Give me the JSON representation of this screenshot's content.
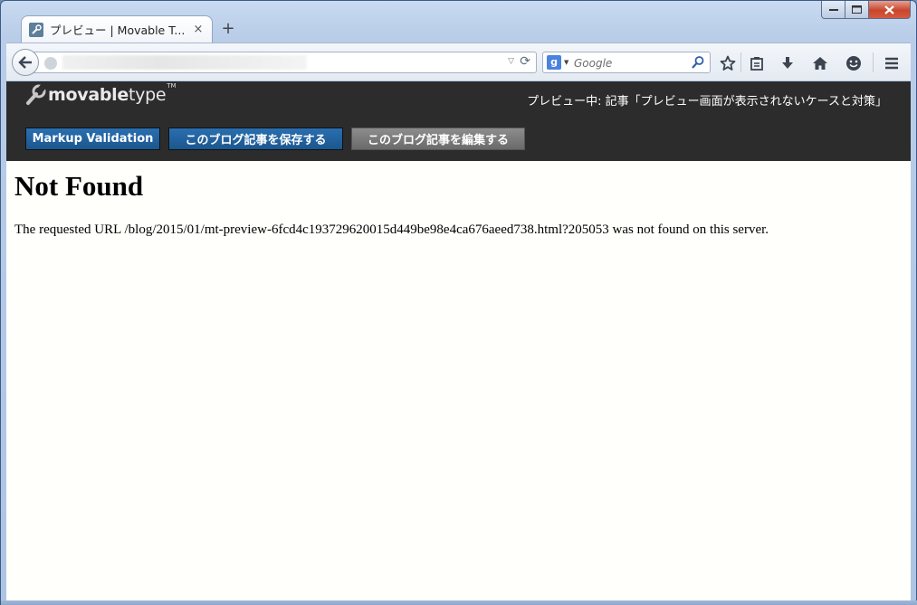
{
  "browser": {
    "tab": {
      "title": "プレビュー | Movable T..."
    },
    "new_tab_glyph": "+",
    "close_tab_glyph": "×",
    "search": {
      "engine_icon": "google-icon",
      "engine_letter": "g",
      "placeholder": "Google"
    },
    "icons": [
      "star-icon",
      "reading-list-icon",
      "download-icon",
      "home-icon",
      "smiley-icon",
      "menu-icon"
    ]
  },
  "mt": {
    "logo": {
      "bold": "movable",
      "regular": "type",
      "tm": "TM"
    },
    "status": "プレビュー中: 記事「プレビュー画面が表示されないケースと対策」",
    "buttons": {
      "validate": "Markup Validation",
      "save": "このブログ記事を保存する",
      "edit": "このブログ記事を編集する"
    },
    "colors": {
      "header_bg": "#2c2c2c",
      "button_blue": "#1f6099",
      "button_gray": "#7a7a7a"
    }
  },
  "content": {
    "title": "Not Found",
    "message": "The requested URL /blog/2015/01/mt-preview-6fcd4c193729620015d449be98e4ca676aeed738.html?205053 was not found on this server."
  }
}
